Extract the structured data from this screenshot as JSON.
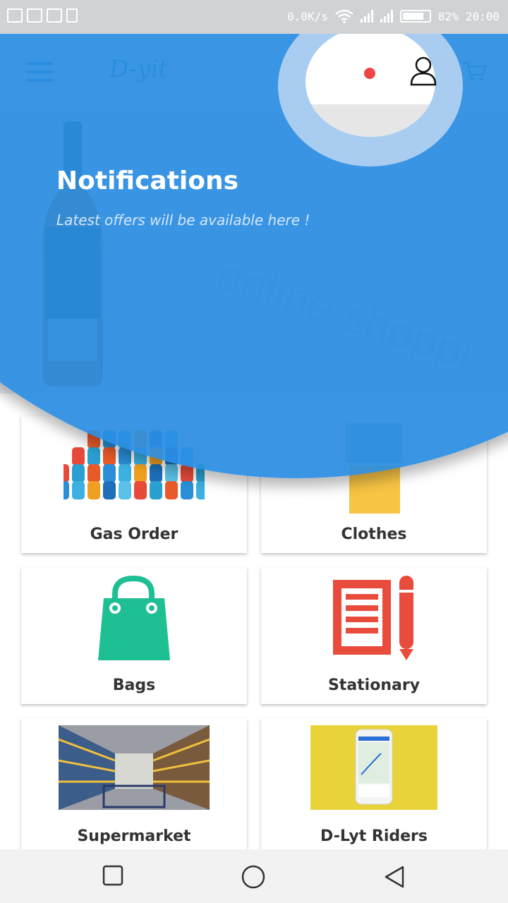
{
  "status_bar": {
    "speed": "0.0K/s",
    "battery": "82%",
    "battery_level": 0.82,
    "time": "20:00"
  },
  "app": {
    "brand": "D-yit",
    "hero_text": "online shoppi"
  },
  "categories": [
    {
      "label": "Gas Order"
    },
    {
      "label": "Clothes"
    },
    {
      "label": "Bags"
    },
    {
      "label": "Stationary"
    },
    {
      "label": "Supermarket"
    },
    {
      "label": "D-Lyt Riders"
    }
  ],
  "overlay": {
    "title": "Notifications",
    "subtitle": "Latest offers will be available here !"
  },
  "colors": {
    "overlay_blue": "#298de2",
    "bag_green": "#1dbf93",
    "stationary_red": "#e94b3c",
    "riders_yellow": "#e8d43a"
  }
}
